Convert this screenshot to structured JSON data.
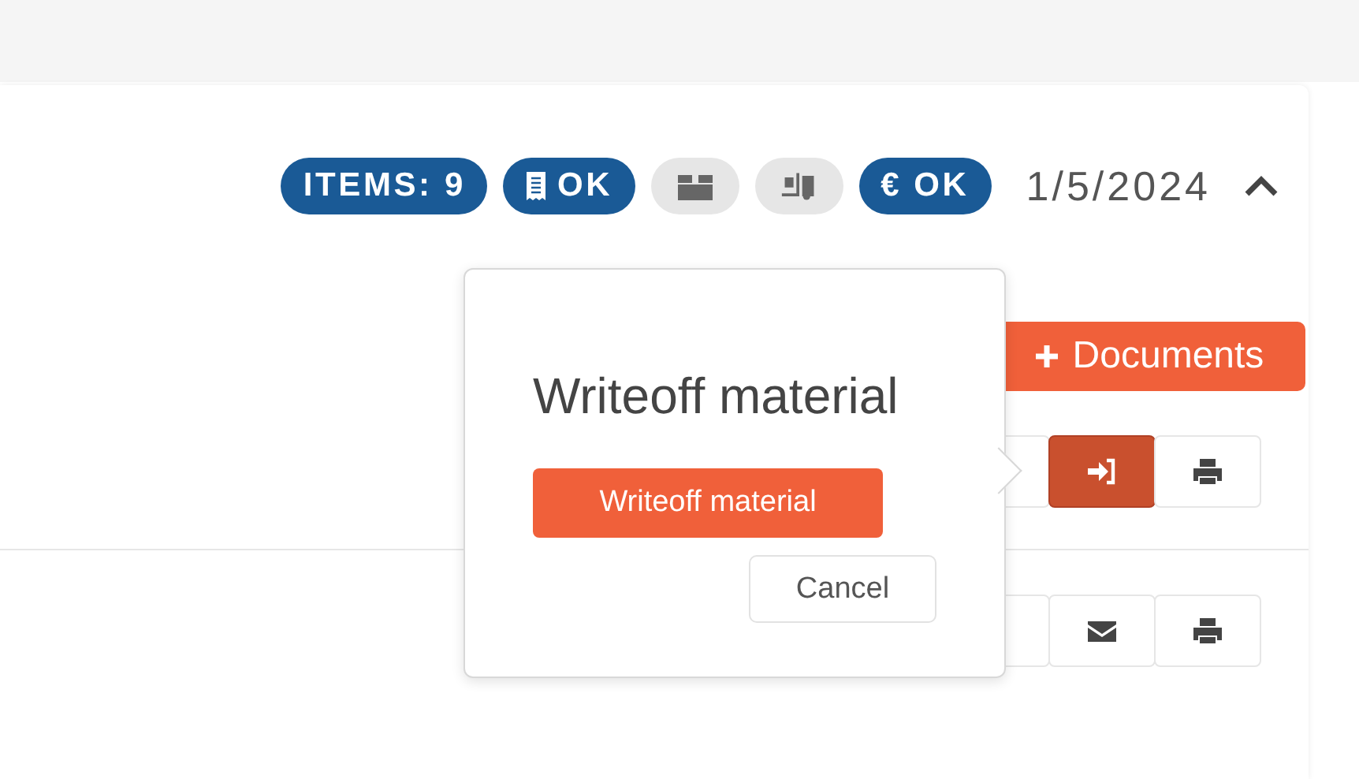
{
  "badges": [
    {
      "kind": "text",
      "label": "ITEMS: 9",
      "active": true
    },
    {
      "kind": "receipt",
      "label": "OK",
      "active": true
    },
    {
      "kind": "box",
      "active": false
    },
    {
      "kind": "forklift",
      "active": false
    },
    {
      "kind": "text",
      "label": "€ OK",
      "active": true
    }
  ],
  "date": "1/5/2024",
  "expanded": true,
  "documents_button": {
    "label": "Documents"
  },
  "rows": [
    {
      "buttons": [
        {
          "kind": "blank",
          "selected": false
        },
        {
          "kind": "signin",
          "selected": true
        },
        {
          "kind": "print",
          "selected": false
        }
      ]
    },
    {
      "buttons": [
        {
          "kind": "blank",
          "selected": false
        },
        {
          "kind": "mail",
          "selected": false
        },
        {
          "kind": "print",
          "selected": false
        }
      ]
    }
  ],
  "popover": {
    "title": "Writeoff material",
    "confirm": "Writeoff material",
    "cancel": "Cancel"
  }
}
